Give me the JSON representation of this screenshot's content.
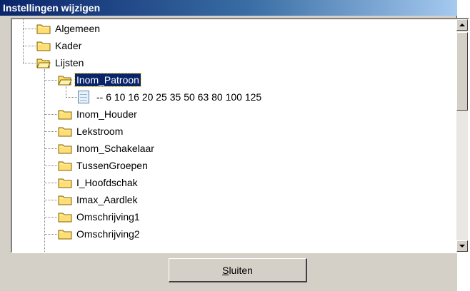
{
  "window": {
    "title": "Instellingen wijzigen"
  },
  "tree": {
    "items": [
      {
        "label": "Algemeen",
        "level": 1,
        "icon": "folder-closed-icon"
      },
      {
        "label": "Kader",
        "level": 1,
        "icon": "folder-closed-icon"
      },
      {
        "label": "Lijsten",
        "level": 1,
        "icon": "folder-open-icon",
        "expanded": true
      },
      {
        "label": "Inom_Patroon",
        "level": 2,
        "icon": "folder-open-icon",
        "expanded": true,
        "selected": true
      },
      {
        "label": "-- 6 10 16 20 25 35 50 63 80 100 125",
        "level": 3,
        "icon": "list-item-icon"
      },
      {
        "label": "Inom_Houder",
        "level": 2,
        "icon": "folder-closed-icon"
      },
      {
        "label": "Lekstroom",
        "level": 2,
        "icon": "folder-closed-icon"
      },
      {
        "label": "Inom_Schakelaar",
        "level": 2,
        "icon": "folder-closed-icon"
      },
      {
        "label": "TussenGroepen",
        "level": 2,
        "icon": "folder-closed-icon"
      },
      {
        "label": "I_Hoofdschak",
        "level": 2,
        "icon": "folder-closed-icon"
      },
      {
        "label": "Imax_Aardlek",
        "level": 2,
        "icon": "folder-closed-icon"
      },
      {
        "label": "Omschrijving1",
        "level": 2,
        "icon": "folder-closed-icon"
      },
      {
        "label": "Omschrijving2",
        "level": 2,
        "icon": "folder-closed-icon"
      }
    ]
  },
  "footer": {
    "close_accel": "S",
    "close_rest": "luiten"
  },
  "colors": {
    "titlebar_start": "#0a246a",
    "titlebar_end": "#a6caf0",
    "selection": "#0a246a",
    "folder_fill": "#ffdf73",
    "dialog_bg": "#d4d0c8"
  }
}
